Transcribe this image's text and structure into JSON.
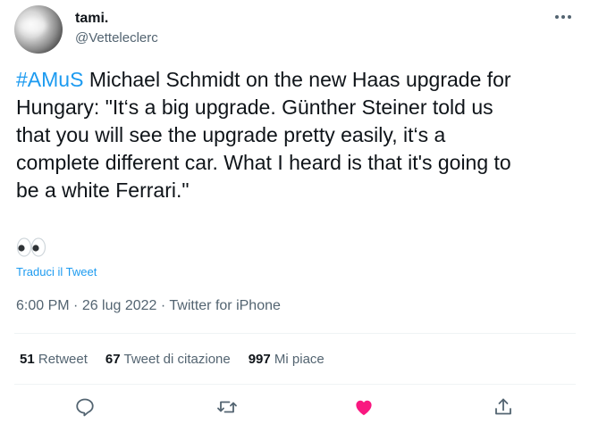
{
  "author": {
    "display_name": "tami.",
    "handle": "@Vetteleclerc"
  },
  "tweet": {
    "hashtag": "#AMuS",
    "text": " Michael Schmidt on the new Haas upgrade for\nHungary: \"It‘s a big upgrade. Günther Steiner told us\nthat you will see the upgrade pretty easily, it‘s a\ncomplete different car. What I heard is that it's going to\nbe a white Ferrari.\"",
    "emoji": "👀",
    "translate_label": "Traduci il Tweet"
  },
  "meta": {
    "time": "6:00 PM",
    "separator1": " · ",
    "date": "26 lug 2022",
    "separator2": " · ",
    "source": "Twitter for iPhone"
  },
  "stats": {
    "retweets_count": "51",
    "retweets_label": "Retweet",
    "quotes_count": "67",
    "quotes_label": "Tweet di citazione",
    "likes_count": "997",
    "likes_label": "Mi piace"
  },
  "icons": {
    "more": "more-horizontal-icon",
    "reply": "reply-bubble-icon",
    "retweet": "retweet-icon",
    "like": "heart-filled-icon",
    "share": "share-upload-icon"
  },
  "colors": {
    "accent": "#1d9bf0",
    "like": "#f91880",
    "secondary_text": "#536471",
    "primary_text": "#0f1419",
    "divider": "#eff3f4"
  }
}
